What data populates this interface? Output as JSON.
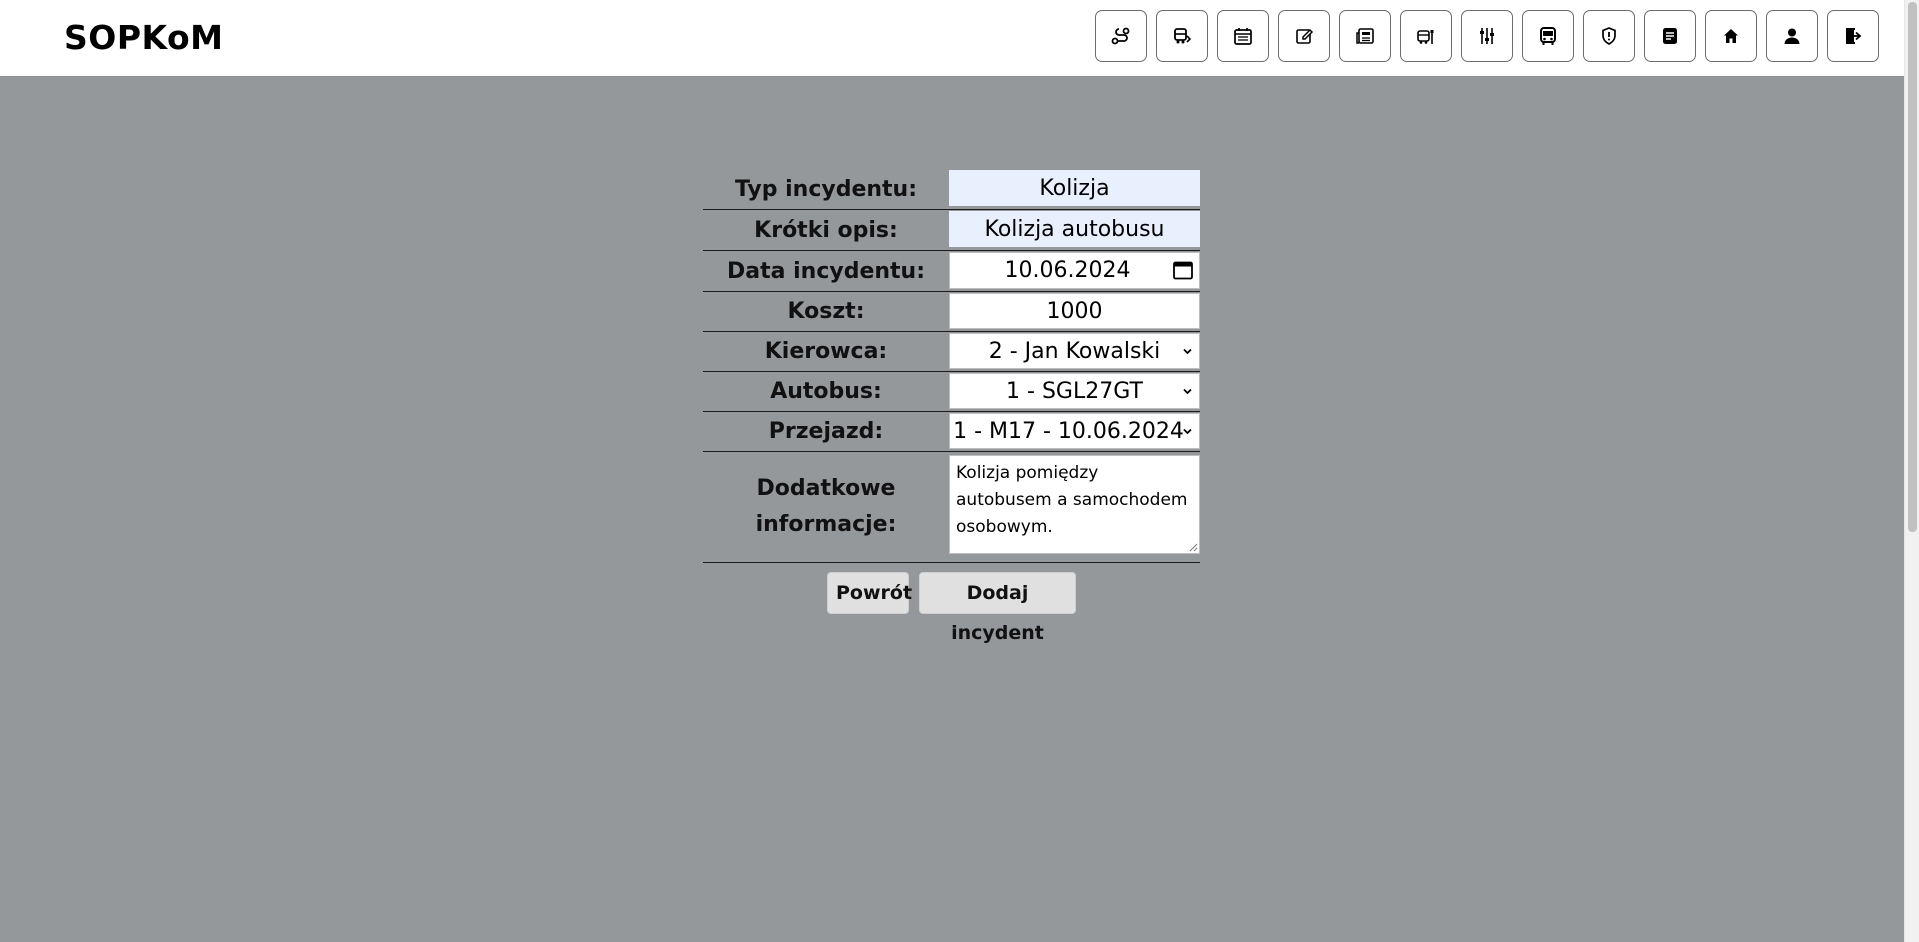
{
  "header": {
    "brand": "SOPKoM",
    "nav_icons": [
      "route-icon",
      "bus-schedule-icon",
      "calendar-icon",
      "edit-icon",
      "news-icon",
      "bus-stop-icon",
      "settings-sliders-icon",
      "bus-icon",
      "shield-icon",
      "document-icon",
      "home-icon",
      "user-icon",
      "logout-icon"
    ]
  },
  "form": {
    "type_label": "Typ incydentu:",
    "type_value": "Kolizja",
    "desc_label": "Krótki opis:",
    "desc_value": "Kolizja autobusu",
    "date_label": "Data incydentu:",
    "date_value": "10.06.2024",
    "cost_label": "Koszt:",
    "cost_value": "1000",
    "driver_label": "Kierowca:",
    "driver_value": "2 - Jan Kowalski",
    "bus_label": "Autobus:",
    "bus_value": "1 - SGL27GT",
    "trip_label": "Przejazd:",
    "trip_value": "1 - M17 - 10.06.2024",
    "info_label_line1": "Dodatkowe",
    "info_label_line2": "informacje:",
    "info_value": "Kolizja pomiędzy autobusem a samochodem osobowym."
  },
  "actions": {
    "back_label": "Powrót",
    "add_label": "Dodaj incydent"
  },
  "colors": {
    "page_background": "#94989b",
    "autofill_background": "#e8f0fe"
  }
}
